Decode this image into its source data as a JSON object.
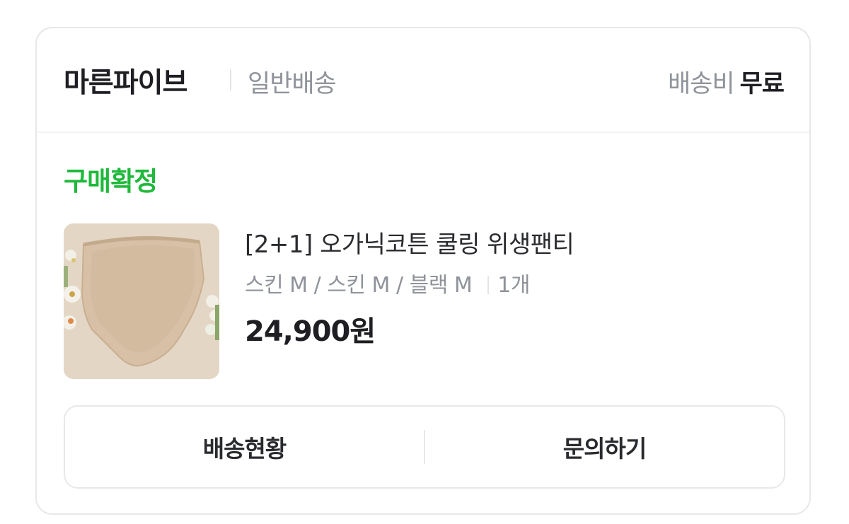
{
  "header": {
    "seller_name": "마른파이브",
    "shipping_type": "일반배송",
    "shipping_fee_label": "배송비",
    "shipping_fee_value": "무료"
  },
  "order": {
    "status": "구매확정",
    "product_name": "[2+1] 오가닉코튼 쿨링 위생팬티",
    "options": "스킨 M / 스킨 M / 블랙 M",
    "quantity": "1개",
    "price": "24,900원"
  },
  "actions": {
    "tracking_label": "배송현황",
    "inquiry_label": "문의하기"
  },
  "colors": {
    "status_green": "#1fb93b",
    "text_dark": "#1e1e23",
    "text_gray": "#8f939a",
    "border": "#e7e8ea"
  }
}
